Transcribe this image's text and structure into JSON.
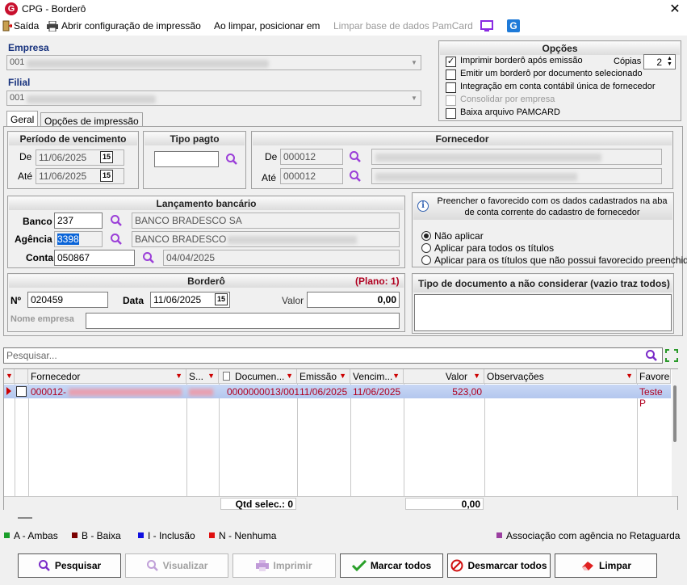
{
  "window": {
    "title": "CPG - Borderô",
    "close": "✕"
  },
  "toolbar": {
    "exit": "Saída",
    "print_config": "Abrir configuração de impressão",
    "on_clear": "Ao limpar, posicionar em",
    "clear_pamcard": "Limpar base de dados PamCard"
  },
  "empresa": {
    "label": "Empresa",
    "value": "001"
  },
  "filial": {
    "label": "Filial",
    "value": "001"
  },
  "opcoes": {
    "title": "Opções",
    "items": [
      {
        "label": "Imprimir borderô após emissão",
        "checked": true
      },
      {
        "label": "Emitir um borderô por documento selecionado",
        "checked": false
      },
      {
        "label": "Integração em conta contábil única de fornecedor",
        "checked": false
      },
      {
        "label": "Consolidar por empresa",
        "checked": false,
        "disabled": true
      },
      {
        "label": "Baixa arquivo PAMCARD",
        "checked": false
      }
    ],
    "copias_label": "Cópias",
    "copias": "2"
  },
  "tabs": [
    "Geral",
    "Opções de impressão"
  ],
  "periodo": {
    "title": "Período de vencimento",
    "de_label": "De",
    "de": "11/06/2025",
    "ate_label": "Até",
    "ate": "11/06/2025"
  },
  "tipo_pagto": {
    "title": "Tipo pagto",
    "value": ""
  },
  "fornecedor": {
    "title": "Fornecedor",
    "de_label": "De",
    "de": "000012",
    "ate_label": "Até",
    "ate": "000012"
  },
  "lancamento": {
    "title": "Lançamento bancário",
    "banco_label": "Banco",
    "banco": "237",
    "banco_nome": "BANCO BRADESCO SA",
    "agencia_label": "Agência",
    "agencia": "3398",
    "agencia_nome": "BANCO BRADESCO -",
    "conta_label": "Conta",
    "conta": "050867",
    "conta_data": "04/04/2025"
  },
  "favorecido": {
    "info": "Preencher o favorecido com os dados cadastrados na aba de conta corrente do cadastro de fornecedor",
    "options": [
      "Não aplicar",
      "Aplicar para todos os títulos",
      "Aplicar para os títulos que não possui favorecido preenchido"
    ],
    "selected": 0
  },
  "bordero": {
    "title": "Borderô",
    "plano": "(Plano: 1)",
    "num_label": "Nº",
    "num": "020459",
    "data_label": "Data",
    "data": "11/06/2025",
    "valor_label": "Valor",
    "valor": "0,00",
    "nome_label": "Nome empresa",
    "nome": ""
  },
  "tipo_doc": {
    "title": "Tipo de documento a não considerar (vazio traz todos)"
  },
  "search": {
    "placeholder": "Pesquisar..."
  },
  "grid": {
    "columns": [
      "Fornecedor",
      "S...",
      "Documen...",
      "Emissão",
      "Vencim...",
      "Valor",
      "Observações",
      "Favorec"
    ],
    "rows": [
      {
        "fornecedor": "000012-",
        "documento": "0000000013/001",
        "emissao": "11/06/2025",
        "vencimento": "11/06/2025",
        "valor": "523,00",
        "favorecido": "Teste P"
      }
    ],
    "footer_label": "Qtd selec.: 0",
    "footer_total": "0,00"
  },
  "legend": [
    {
      "label": "A - Ambas",
      "color": "#1a9e2a"
    },
    {
      "label": "B - Baixa",
      "color": "#7a0000"
    },
    {
      "label": "I - Inclusão",
      "color": "#1010e0"
    },
    {
      "label": "N - Nenhuma",
      "color": "#e01010"
    }
  ],
  "legend_right": {
    "label": "Associação com agência no Retaguarda",
    "color": "#9b3fa0"
  },
  "buttons": {
    "pesquisar": "Pesquisar",
    "visualizar": "Visualizar",
    "imprimir": "Imprimir",
    "marcar": "Marcar todos",
    "desmarcar": "Desmarcar todos",
    "limpar": "Limpar"
  }
}
